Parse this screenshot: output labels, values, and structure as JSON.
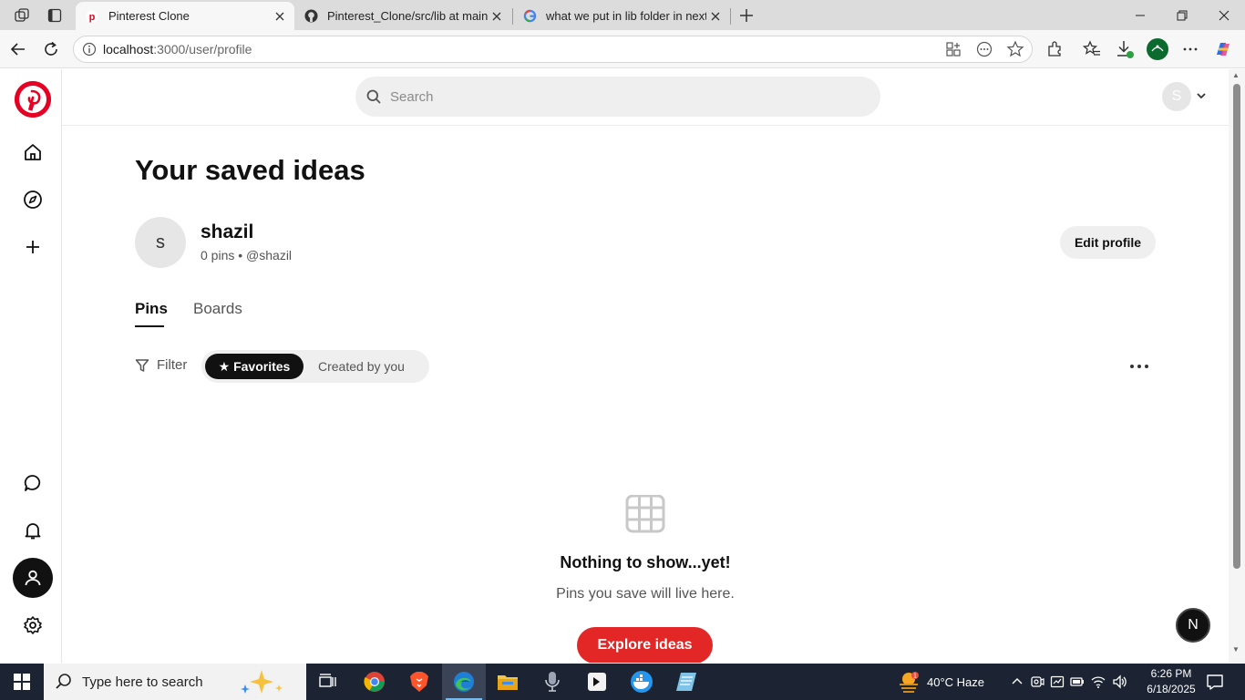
{
  "browser": {
    "tabs": [
      {
        "title": "Pinterest Clone",
        "active": true
      },
      {
        "title": "Pinterest_Clone/src/lib at main · M",
        "active": false
      },
      {
        "title": "what we put in lib folder in nextjs",
        "active": false
      }
    ],
    "url_host": "localhost",
    "url_rest": ":3000/user/profile"
  },
  "topbar": {
    "search_placeholder": "Search",
    "avatar_letter": "S"
  },
  "profile": {
    "heading": "Your saved ideas",
    "avatar_letter": "s",
    "name": "shazil",
    "meta": "0 pins • @shazil",
    "edit_label": "Edit profile"
  },
  "tabs": {
    "pins": "Pins",
    "boards": "Boards"
  },
  "filters": {
    "filter_label": "Filter",
    "favorites_label": "★ Favorites",
    "created_label": "Created by you"
  },
  "empty": {
    "title": "Nothing to show...yet!",
    "subtitle": "Pins you save will live here.",
    "cta": "Explore ideas"
  },
  "badge_letter": "N",
  "taskbar": {
    "search_label": "Type here to search",
    "weather": "40°C  Haze",
    "time": "6:26 PM",
    "date": "6/18/2025"
  },
  "colors": {
    "brand": "#e60023",
    "cta": "#e32626"
  }
}
